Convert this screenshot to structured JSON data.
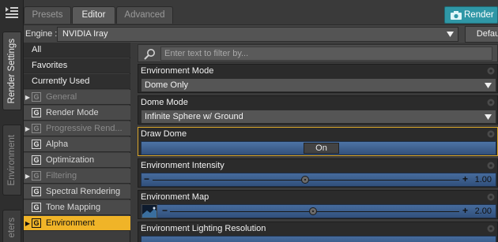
{
  "left_strip": {
    "tabs": [
      {
        "label": "Render Settings"
      },
      {
        "label": "Environment"
      },
      {
        "label": "eters"
      }
    ]
  },
  "top_tabs": [
    {
      "label": "Presets"
    },
    {
      "label": "Editor"
    },
    {
      "label": "Advanced"
    }
  ],
  "render_button": {
    "label": "Render"
  },
  "engine": {
    "label": "Engine :",
    "value": "NVIDIA Iray",
    "defaults_label": "Defaults"
  },
  "categories": [
    {
      "label": "All",
      "style": "plain"
    },
    {
      "label": "Favorites",
      "style": "plain"
    },
    {
      "label": "Currently Used",
      "style": "plain"
    },
    {
      "label": "General",
      "expandable": true,
      "disabled": true,
      "group": "G"
    },
    {
      "label": "Render Mode",
      "group": "G"
    },
    {
      "label": "Progressive Rend...",
      "expandable": true,
      "disabled": true,
      "group": "G"
    },
    {
      "label": "Alpha",
      "group": "G"
    },
    {
      "label": "Optimization",
      "group": "G"
    },
    {
      "label": "Filtering",
      "expandable": true,
      "disabled": true,
      "group": "G"
    },
    {
      "label": "Spectral Rendering",
      "group": "G"
    },
    {
      "label": "Tone Mapping",
      "group": "G"
    },
    {
      "label": "Environment",
      "expandable": true,
      "selected": true,
      "group": "G"
    }
  ],
  "filter": {
    "placeholder": "Enter text to filter by..."
  },
  "properties": {
    "env_mode": {
      "title": "Environment Mode",
      "value": "Dome Only"
    },
    "dome_mode": {
      "title": "Dome Mode",
      "value": "Infinite Sphere w/ Ground"
    },
    "draw_dome": {
      "title": "Draw Dome",
      "value": "On"
    },
    "env_intensity": {
      "title": "Environment Intensity",
      "value": "1.00",
      "fraction": 0.5
    },
    "env_map": {
      "title": "Environment Map",
      "value": "2.00",
      "fraction": 0.5
    },
    "env_light_res": {
      "title": "Environment Lighting Resolution"
    }
  },
  "colors": {
    "accent_selected": "#f0b428",
    "render_button": "#2f97a6",
    "slider_blue": "#466b9c"
  }
}
